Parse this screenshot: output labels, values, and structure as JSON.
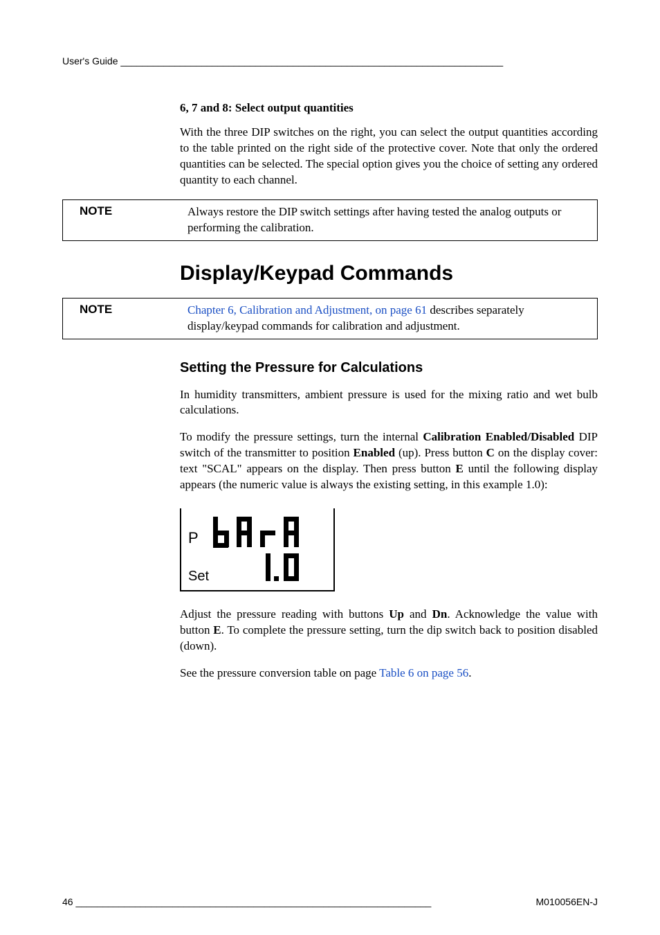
{
  "header": "User's Guide _______________________________________________________________________",
  "sub678": "6, 7 and 8: Select output quantities",
  "p1": "With the three DIP switches on the right, you can select the output quantities according to the table printed on the right side of the protective cover. Note that only the ordered quantities can be selected. The special option gives you the choice of setting any ordered quantity to each channel.",
  "note1": {
    "label": "NOTE",
    "text": "Always restore the DIP switch settings after having tested the analog outputs or performing the calibration."
  },
  "h1": "Display/Keypad Commands",
  "note2": {
    "label": "NOTE",
    "link": "Chapter 6, Calibration and Adjustment, on page 61",
    "rest": " describes separately display/keypad commands for calibration and adjustment."
  },
  "h2": "Setting the Pressure for Calculations",
  "p2": "In humidity transmitters, ambient pressure is used for the mixing ratio and wet bulb calculations.",
  "p3a": "To modify the pressure settings, turn the internal ",
  "p3b": "Calibration Enabled/Disabled",
  "p3c": " DIP switch of the transmitter to position ",
  "p3d": "Enabled",
  "p3e": " (up). Press button ",
  "p3f": "C",
  "p3g": " on the display cover: text \"SCAL\" appears on the display. Then press button ",
  "p3h": "E",
  "p3i": " until the following display appears (the numeric value is always the existing setting, in this example 1.0):",
  "seg": {
    "p": "P",
    "set": "Set"
  },
  "p4a": "Adjust the pressure reading with buttons ",
  "p4b": "Up",
  "p4c": " and ",
  "p4d": "Dn",
  "p4e": ". Acknowledge the value with button ",
  "p4f": "E",
  "p4g": ". To complete the pressure setting, turn the dip switch back to position disabled (down).",
  "p5a": "See the pressure conversion table on page ",
  "p5link": "Table 6 on page 56",
  "p5b": ".",
  "footer": {
    "page": "46 __________________________________________________________________",
    "doc": "M010056EN-J"
  }
}
